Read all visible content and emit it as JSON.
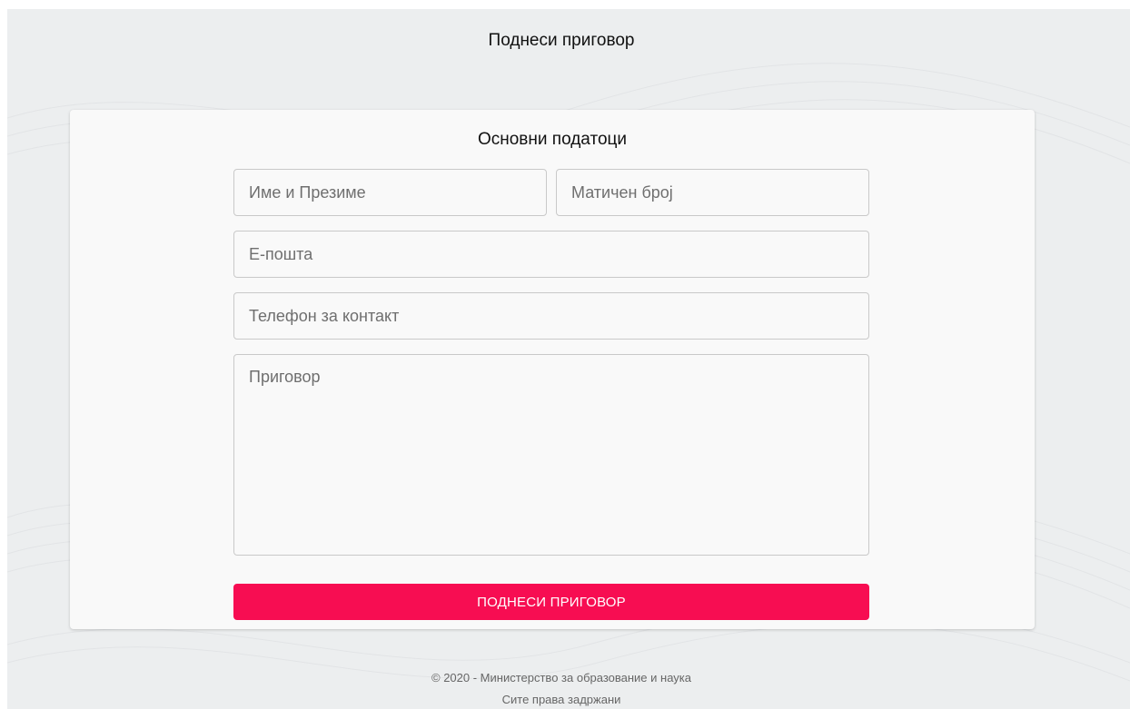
{
  "header": {
    "title": "Поднеси приговор"
  },
  "form": {
    "section_title": "Основни податоци",
    "name": {
      "placeholder": "Име и Презиме",
      "value": ""
    },
    "id_number": {
      "placeholder": "Матичен број",
      "value": ""
    },
    "email": {
      "placeholder": "Е-пошта",
      "value": ""
    },
    "phone": {
      "placeholder": "Телефон за контакт",
      "value": ""
    },
    "complaint": {
      "placeholder": "Приговор",
      "value": ""
    },
    "submit_label": "ПОДНЕСИ ПРИГОВОР"
  },
  "footer": {
    "copyright": "© 2020 - Министерство за образование и наука",
    "rights": "Сите права задржани"
  },
  "colors": {
    "accent": "#f70d52",
    "background": "#eceeef",
    "card": "#f9f9f9"
  }
}
